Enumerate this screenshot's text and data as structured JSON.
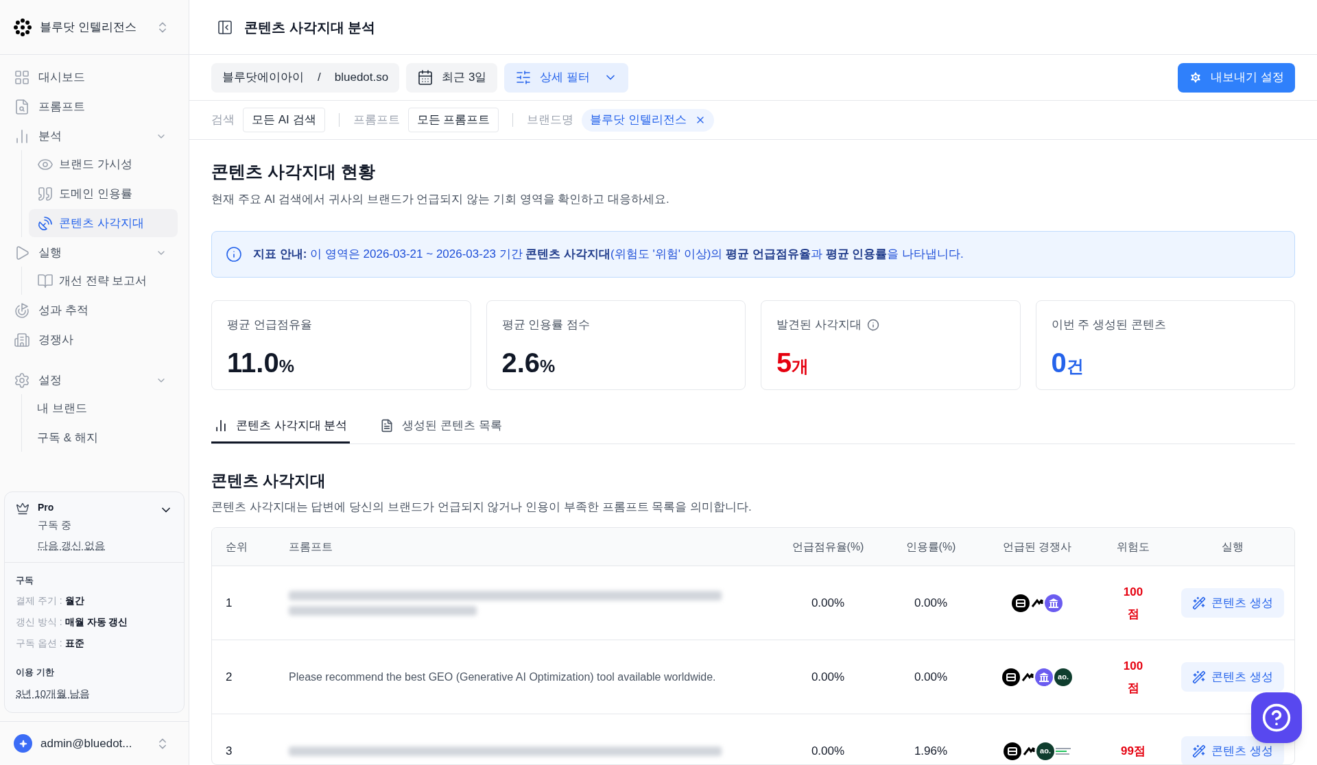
{
  "workspace": {
    "name": "블루닷 인텔리전스"
  },
  "nav": [
    {
      "label": "대시보드",
      "selected": false
    },
    {
      "label": "프롬프트",
      "selected": false
    },
    {
      "label": "분석",
      "selected": false,
      "expanded": true,
      "children": [
        {
          "label": "브랜드 가시성",
          "selected": false
        },
        {
          "label": "도메인 인용률",
          "selected": false
        },
        {
          "label": "콘텐츠 사각지대",
          "selected": true
        }
      ]
    },
    {
      "label": "실행",
      "selected": false,
      "expanded": true,
      "children": [
        {
          "label": "개선 전략 보고서",
          "selected": false
        }
      ]
    },
    {
      "label": "성과 추적",
      "selected": false
    },
    {
      "label": "경쟁사",
      "selected": false
    },
    {
      "label": "설정",
      "selected": false,
      "expanded": true,
      "children": [
        {
          "label": "내 브랜드",
          "selected": false
        },
        {
          "label": "구독 & 해지",
          "selected": false
        }
      ]
    }
  ],
  "plan": {
    "name": "Pro",
    "status": "구독 중",
    "renewal": "다음 갱신 없음",
    "expanded": true,
    "section": "구독",
    "rows": [
      {
        "label": "결제 주기 :",
        "value": "월간"
      },
      {
        "label": "갱신 방식 :",
        "value": "매월 자동 갱신"
      },
      {
        "label": "구독 옵션 :",
        "value": "표준"
      }
    ],
    "limit_title": "이용 기한",
    "limit_value": "3년 10개월 남음"
  },
  "user": {
    "email": "admin@bluedot..."
  },
  "header": {
    "title": "콘텐츠 사각지대 분석"
  },
  "toolbar": {
    "org": "블루닷에이아이",
    "separator": "/",
    "domain": "bluedot.so",
    "period": "최근 3일",
    "filter": "상세 필터",
    "export": "내보내기 설정"
  },
  "filters": [
    {
      "label": "검색",
      "value": "모든 AI 검색",
      "kind": "box"
    },
    {
      "label": "프롬프트",
      "value": "모든 프롬프트",
      "kind": "box"
    },
    {
      "label": "브랜드명",
      "value": "블루닷 인텔리전스",
      "kind": "tag"
    }
  ],
  "section": {
    "title": "콘텐츠 사각지대 현황",
    "subtitle": "현재 주요 AI 검색에서 귀사의 브랜드가 언급되지 않는 기회 영역을 확인하고 대응하세요."
  },
  "notice": "**지표 안내:** 이 영역은 2026-03-21 ~ 2026-03-23 기간 **콘텐츠 사각지대**(위험도 '위험' 이상)의 **평균 언급점유율**과 **평균 인용률**을 나타냅니다.",
  "cards": [
    {
      "label": "평균 언급점유율",
      "value": "11.0",
      "unit": "%",
      "color": "#111827",
      "info": false
    },
    {
      "label": "평균 인용률 점수",
      "value": "2.6",
      "unit": "%",
      "color": "#111827",
      "info": false
    },
    {
      "label": "발견된 사각지대",
      "value": "5",
      "unit": "개",
      "color": "#e5000f",
      "info": true
    },
    {
      "label": "이번 주 생성된 콘텐츠",
      "value": "0",
      "unit": "건",
      "color": "#2563eb",
      "info": false
    }
  ],
  "tabs": [
    {
      "label": "콘텐츠 사각지대 분석",
      "selected": true
    },
    {
      "label": "생성된 콘텐츠 목록",
      "selected": false
    }
  ],
  "blindspots": {
    "title": "콘텐츠 사각지대",
    "subtitle": "콘텐츠 사각지대는 답변에 당신의 브랜드가 언급되지 않거나 인용이 부족한 프롬프트 목록을 의미합니다.",
    "columns": [
      "순위",
      "프롬프트",
      "언급점유율(%)",
      "인용률(%)",
      "언급된 경쟁사",
      "위험도",
      "실행"
    ],
    "rows": [
      {
        "rank": "1",
        "prompt_hidden": true,
        "mention": "0.00%",
        "citation": "0.00%",
        "competitors": [
          {
            "kind": "square"
          },
          {
            "kind": "arrow"
          },
          {
            "kind": "bank"
          }
        ],
        "risk": "100점",
        "action": "콘텐츠 생성"
      },
      {
        "rank": "2",
        "prompt_hidden": false,
        "prompt": "Please recommend the best GEO (Generative AI Optimization) tool available worldwide.",
        "mention": "0.00%",
        "citation": "0.00%",
        "competitors": [
          {
            "kind": "square"
          },
          {
            "kind": "arrow"
          },
          {
            "kind": "bank"
          },
          {
            "kind": "text",
            "label": "ao."
          }
        ],
        "risk": "100점",
        "action": "콘텐츠 생성"
      },
      {
        "rank": "3",
        "prompt_hidden": true,
        "mention": "0.00%",
        "citation": "1.96%",
        "competitors": [
          {
            "kind": "square"
          },
          {
            "kind": "arrow"
          },
          {
            "kind": "text",
            "label": "ao."
          },
          {
            "kind": "lines"
          }
        ],
        "risk": "99점",
        "action": "콘텐츠 생성"
      }
    ]
  }
}
